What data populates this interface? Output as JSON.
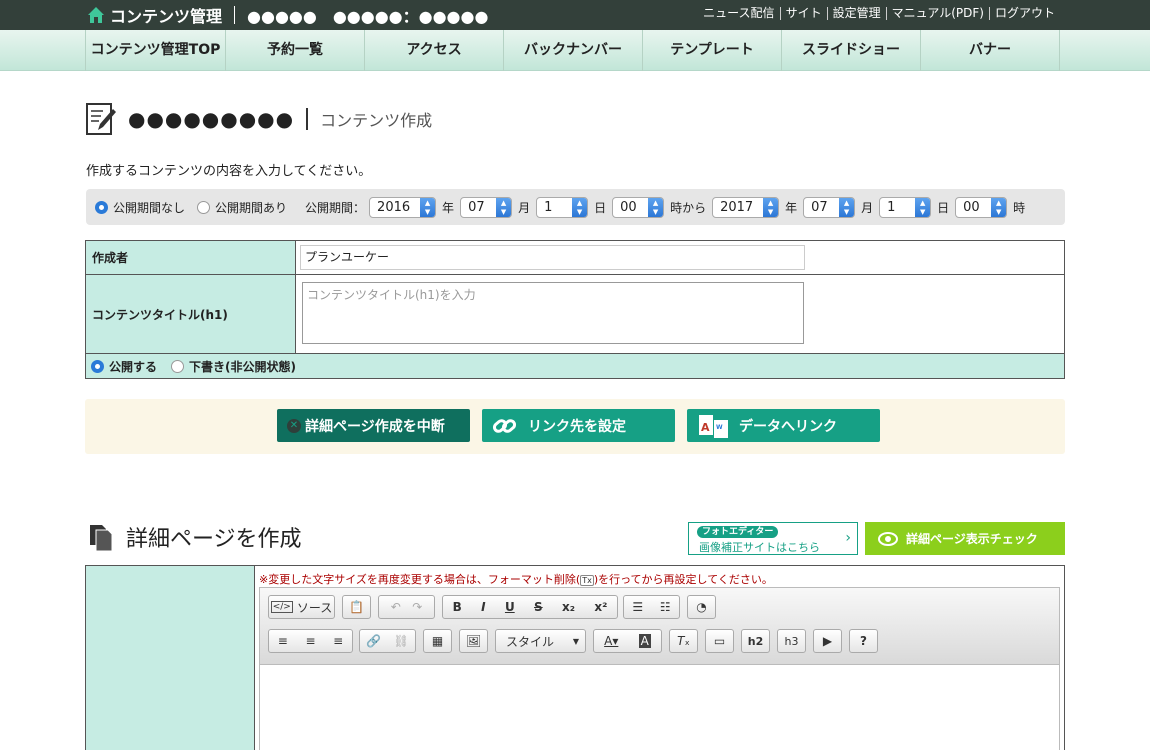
{
  "topbar": {
    "app_title": "コンテンツ管理",
    "shop_name": "●●●●●　●●●●●：●●●●●",
    "links": [
      "ニュース配信",
      "サイト",
      "設定管理",
      "マニュアル(PDF)",
      "ログアウト"
    ]
  },
  "nav": [
    "コンテンツ管理TOP",
    "予約一覧",
    "アクセス",
    "バックナンバー",
    "テンプレート",
    "スライドショー",
    "バナー"
  ],
  "page": {
    "title": "●●●●●●●●●",
    "subtitle": "コンテンツ作成",
    "description": "作成するコンテンツの内容を入力してください。"
  },
  "period": {
    "option_none": "公開期間なし",
    "option_set": "公開期間あり",
    "label": "公開期間：",
    "start_year": "2016",
    "start_month": "07",
    "start_day": "1",
    "start_hour": "00",
    "end_year": "2017",
    "end_month": "07",
    "end_day": "1",
    "end_hour": "00",
    "unit_year": "年",
    "unit_month": "月",
    "unit_day": "日",
    "unit_hour_from": "時から",
    "unit_hour": "時"
  },
  "form": {
    "author_label": "作成者",
    "author_value": "プランユーケー",
    "title_label": "コンテンツタイトル(h1)",
    "title_placeholder": "コンテンツタイトル(h1)を入力",
    "publish_label": "公開する",
    "draft_label": "下書き(非公開状態)"
  },
  "actions": {
    "cancel": "詳細ページ作成を中断",
    "link": "リンク先を設定",
    "data_link": "データへリンク"
  },
  "detail": {
    "heading": "詳細ページを作成",
    "photo_badge": "フォトエディター",
    "photo_link": "画像補正サイトはこちら",
    "preview_check": "詳細ページ表示チェック",
    "warning": "※変更した文字サイズを再度変更する場合は、フォーマット削除(",
    "warning_icon": "Tx",
    "warning_tail": ")を行ってから再設定してください。",
    "source_btn": "ソース",
    "style_btn": "スタイル"
  },
  "colors": {
    "accent": "#16a085",
    "dark_accent": "#0f6f5e",
    "topbar": "#33403a",
    "green_btn": "#8ccf1c"
  }
}
